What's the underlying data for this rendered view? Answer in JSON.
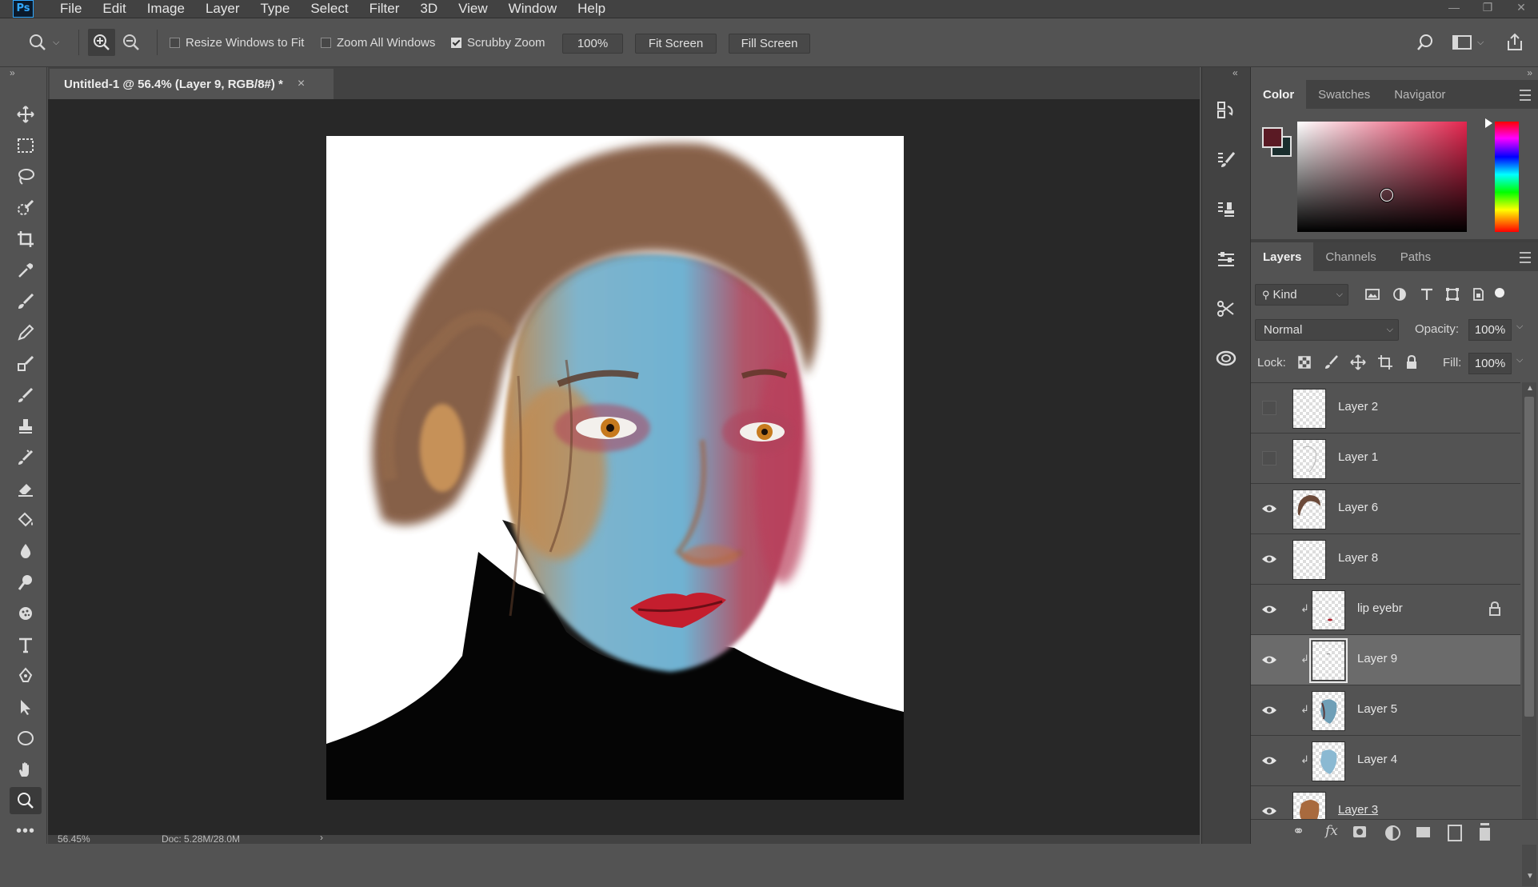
{
  "app": {
    "logo": "Ps"
  },
  "menu": [
    "File",
    "Edit",
    "Image",
    "Layer",
    "Type",
    "Select",
    "Filter",
    "3D",
    "View",
    "Window",
    "Help"
  ],
  "options": {
    "resize_windows": {
      "label": "Resize Windows to Fit",
      "checked": false
    },
    "zoom_all": {
      "label": "Zoom All Windows",
      "checked": false
    },
    "scrubby": {
      "label": "Scrubby Zoom",
      "checked": true
    },
    "zoom_value": "100%",
    "fit_screen": "Fit Screen",
    "fill_screen": "Fill Screen"
  },
  "document": {
    "tab_title": "Untitled-1 @ 56.4% (Layer 9, RGB/8#) *",
    "close": "×",
    "status_zoom": "56.45%",
    "status_doc": "Doc: 5.28M/28.0M"
  },
  "color_panel": {
    "tabs": [
      "Color",
      "Swatches",
      "Navigator"
    ],
    "foreground": "#5a1a24",
    "background": "#1a2e2e"
  },
  "layers_panel": {
    "tabs": [
      "Layers",
      "Channels",
      "Paths"
    ],
    "filter_kind": "Kind",
    "blend_mode": "Normal",
    "opacity_label": "Opacity:",
    "opacity_value": "100%",
    "lock_label": "Lock:",
    "fill_label": "Fill:",
    "fill_value": "100%",
    "layers": [
      {
        "name": "Layer 2",
        "visible": false,
        "clipped": false,
        "locked": false,
        "selected": false
      },
      {
        "name": "Layer 1",
        "visible": false,
        "clipped": false,
        "locked": false,
        "selected": false
      },
      {
        "name": "Layer 6",
        "visible": true,
        "clipped": false,
        "locked": false,
        "selected": false
      },
      {
        "name": "Layer 8",
        "visible": true,
        "clipped": false,
        "locked": false,
        "selected": false
      },
      {
        "name": "lip eyebr",
        "visible": true,
        "clipped": true,
        "locked": true,
        "selected": false
      },
      {
        "name": "Layer 9",
        "visible": true,
        "clipped": true,
        "locked": false,
        "selected": true
      },
      {
        "name": "Layer 5",
        "visible": true,
        "clipped": true,
        "locked": false,
        "selected": false
      },
      {
        "name": "Layer 4",
        "visible": true,
        "clipped": true,
        "locked": false,
        "selected": false
      },
      {
        "name": "Layer 3",
        "visible": true,
        "clipped": false,
        "locked": false,
        "selected": false
      }
    ]
  }
}
